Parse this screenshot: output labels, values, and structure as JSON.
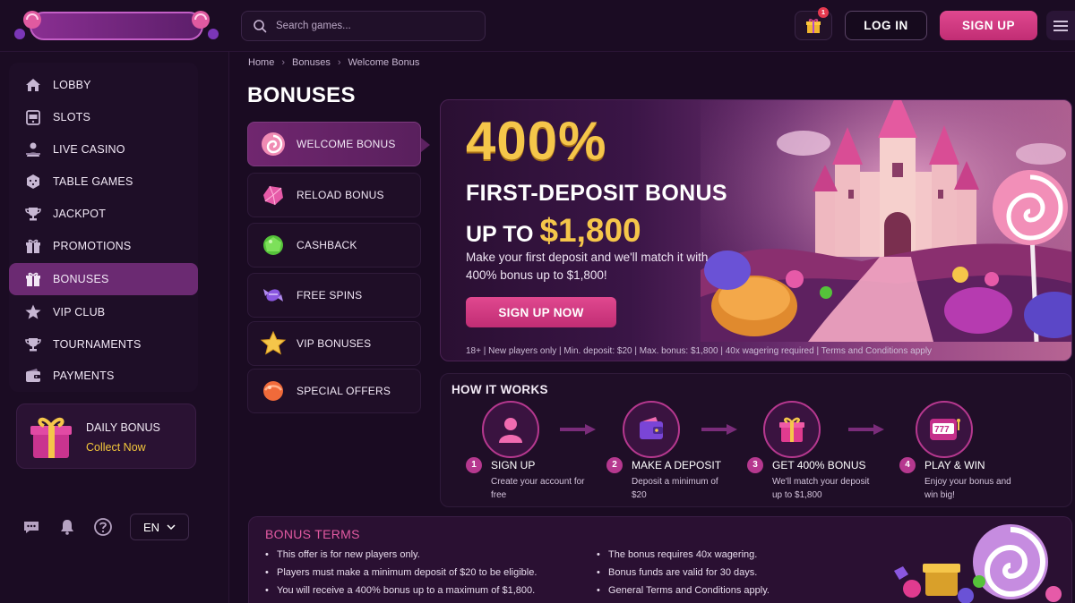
{
  "header": {
    "search_placeholder": "Search games...",
    "gift_badge": "1",
    "login_label": "LOG IN",
    "signup_label": "SIGN UP"
  },
  "sidebar": {
    "items": [
      {
        "label": "LOBBY",
        "icon": "home-icon"
      },
      {
        "label": "SLOTS",
        "icon": "slot-machine-icon"
      },
      {
        "label": "LIVE CASINO",
        "icon": "dealer-icon"
      },
      {
        "label": "TABLE GAMES",
        "icon": "dice-icon"
      },
      {
        "label": "JACKPOT",
        "icon": "trophy-cup-icon"
      },
      {
        "label": "PROMOTIONS",
        "icon": "gift-icon"
      },
      {
        "label": "BONUSES",
        "icon": "gift-icon",
        "active": true
      },
      {
        "label": "VIP CLUB",
        "icon": "star-icon"
      },
      {
        "label": "TOURNAMENTS",
        "icon": "trophy-icon"
      },
      {
        "label": "PAYMENTS",
        "icon": "wallet-icon"
      }
    ],
    "daily_bonus": {
      "title": "DAILY BONUS",
      "action": "Collect Now"
    },
    "language": "EN"
  },
  "breadcrumb": [
    "Home",
    "Bonuses",
    "Welcome Bonus"
  ],
  "page_title": "BONUSES",
  "categories": [
    {
      "label": "WELCOME BONUS",
      "icon": "swirl-candy-icon",
      "active": true
    },
    {
      "label": "RELOAD BONUS",
      "icon": "pink-candy-icon"
    },
    {
      "label": "CASHBACK",
      "icon": "green-candy-icon"
    },
    {
      "label": "FREE SPINS",
      "icon": "wrapped-candy-icon"
    },
    {
      "label": "VIP BONUSES",
      "icon": "star-candy-icon"
    },
    {
      "label": "SPECIAL OFFERS",
      "icon": "orange-candy-icon"
    }
  ],
  "hero": {
    "percent": "400%",
    "line2": "FIRST-DEPOSIT BONUS",
    "line3_prefix": "UP TO",
    "line3_amount": "$1,800",
    "description": "Make your first deposit and we'll match it with 400% bonus up to $1,800!",
    "cta": "SIGN UP NOW",
    "fine_print": "18+ | New players only | Min. deposit: $20 | Max. bonus: $1,800 | 40x wagering required | Terms and Conditions apply"
  },
  "how_it_works": {
    "title": "HOW IT WORKS",
    "steps": [
      {
        "num": "1",
        "title": "SIGN UP",
        "desc": "Create your account for free",
        "icon": "user-icon"
      },
      {
        "num": "2",
        "title": "MAKE A DEPOSIT",
        "desc": "Deposit a minimum of $20",
        "icon": "wallet-icon"
      },
      {
        "num": "3",
        "title": "GET 400% BONUS",
        "desc": "We'll match your deposit up to $1,800",
        "icon": "gift-icon"
      },
      {
        "num": "4",
        "title": "PLAY & WIN",
        "desc": "Enjoy your bonus and win big!",
        "icon": "slot-777-icon"
      }
    ]
  },
  "terms": {
    "title": "BONUS TERMS",
    "left": [
      "This offer is for new players only.",
      "Players must make a minimum deposit of $20 to be eligible.",
      "You will receive a 400% bonus up to a maximum of $1,800."
    ],
    "right": [
      "The bonus requires 40x wagering.",
      "Bonus funds are valid for 30 days.",
      "General Terms and Conditions apply."
    ]
  },
  "colors": {
    "accent_pink": "#c12d74",
    "gold": "#f5c64a",
    "active_nav": "#6b2a72",
    "background": "#1a0b22"
  }
}
